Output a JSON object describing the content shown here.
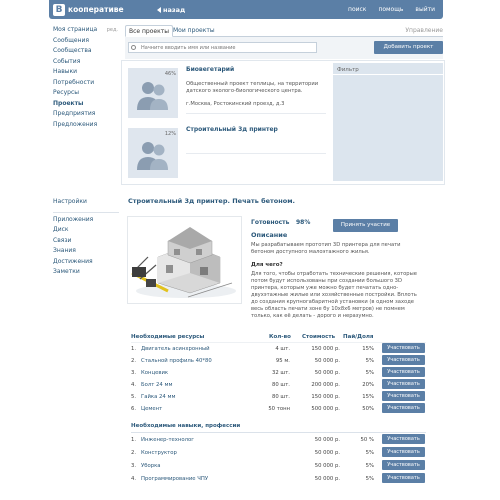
{
  "header": {
    "logo_letter": "В",
    "logo_text": "кооперативе",
    "back": "назад",
    "links": [
      "поиск",
      "помощь",
      "выйти"
    ]
  },
  "sidebar": {
    "edit": "ред.",
    "items": [
      {
        "label": "Моя страница",
        "active": false
      },
      {
        "label": "Сообщения",
        "active": false
      },
      {
        "label": "Сообщества",
        "active": false
      },
      {
        "label": "События",
        "active": false
      },
      {
        "label": "Навыки",
        "active": false
      },
      {
        "label": "Потребности",
        "active": false
      },
      {
        "label": "Ресурсы",
        "active": false
      },
      {
        "label": "Проекты",
        "active": true
      },
      {
        "label": "Предприятия",
        "active": false
      },
      {
        "label": "Предложения",
        "active": false
      }
    ],
    "items2": [
      "Настройки",
      "Приложения",
      "Диск",
      "Связи",
      "Знания",
      "Достижения",
      "Заметки"
    ]
  },
  "tabs": {
    "all": "Все проекты",
    "mine": "Мои проекты",
    "manage": "Управление"
  },
  "search": {
    "placeholder": "Начните вводить имя или название",
    "add_button": "Добавить проект"
  },
  "projects": [
    {
      "title": "Биовегетарий",
      "percent": "46%",
      "description": "Общественный проект теплицы, на территории датского эколого-биологического центра.",
      "address": "г.Москва, Ростокинский проезд, д.3"
    },
    {
      "title": "Строительный 3д принтер",
      "percent": "12%",
      "description": "",
      "address": ""
    }
  ],
  "filter": {
    "title": "Фильтр"
  },
  "detail": {
    "title": "Строительный 3д принтер. Печать бетоном.",
    "ready_label": "Готовность",
    "ready_value": "98%",
    "join_button": "Принять участие",
    "desc_heading": "Описание",
    "desc_text": "Мы разрабатываем прототип 3D принтера для печати бетоном доступного малоэтажного жилья.",
    "why_heading": "Для чего?",
    "why_text": "Для того, чтобы отработать технические решения, которые потом будут использованы при создании большого 3D принтера, которым уже можно будет печатать одно- двухэтажные жилые или хозяйственные постройки. Вплоть до создания крупногабаритной установки (в одном заходе весь область печати зоне бу 10х8х6 метров) не помнем только, как её делать - дорого и неразумно."
  },
  "resources": {
    "headers": [
      "Необходимые ресурсы",
      "Кол-во",
      "Стоимость",
      "Пай/Доля"
    ],
    "rows": [
      {
        "num": "1.",
        "name": "Двигатель асинхронный",
        "qty": "4 шт.",
        "cost": "150 000 р.",
        "share": "15%",
        "button": "Участвовать"
      },
      {
        "num": "2.",
        "name": "Стальной профиль 40*80",
        "qty": "95 м.",
        "cost": "50 000 р.",
        "share": "5%",
        "button": "Участвовать"
      },
      {
        "num": "3.",
        "name": "Концевик",
        "qty": "32 шт.",
        "cost": "50 000 р.",
        "share": "5%",
        "button": "Участвовать"
      },
      {
        "num": "4.",
        "name": "Болт 24 мм",
        "qty": "80 шт.",
        "cost": "200 000 р.",
        "share": "20%",
        "button": "Участвовать"
      },
      {
        "num": "5.",
        "name": "Гайка 24 мм",
        "qty": "80 шт.",
        "cost": "150 000 р.",
        "share": "15%",
        "button": "Участвовать"
      },
      {
        "num": "6.",
        "name": "Цемент",
        "qty": "50 тонн",
        "cost": "500 000 р.",
        "share": "50%",
        "button": "Участвовать"
      }
    ]
  },
  "skills": {
    "heading": "Необходимые навыки, профессии",
    "rows": [
      {
        "num": "1.",
        "name": "Инженер-технолог",
        "cost": "50 000 р.",
        "share": "50 %",
        "button": "Участвовать"
      },
      {
        "num": "2.",
        "name": "Конструктор",
        "cost": "50 000 р.",
        "share": "5%",
        "button": "Участвовать"
      },
      {
        "num": "3.",
        "name": "Уборка",
        "cost": "50 000 р.",
        "share": "5%",
        "button": "Участвовать"
      },
      {
        "num": "4.",
        "name": "Программирование ЧПУ",
        "cost": "50 000 р.",
        "share": "5%",
        "button": "Участвовать"
      }
    ]
  },
  "colors": {
    "accent": "#5b7fa6",
    "link": "#2b587a",
    "panel": "#dce5ee"
  }
}
